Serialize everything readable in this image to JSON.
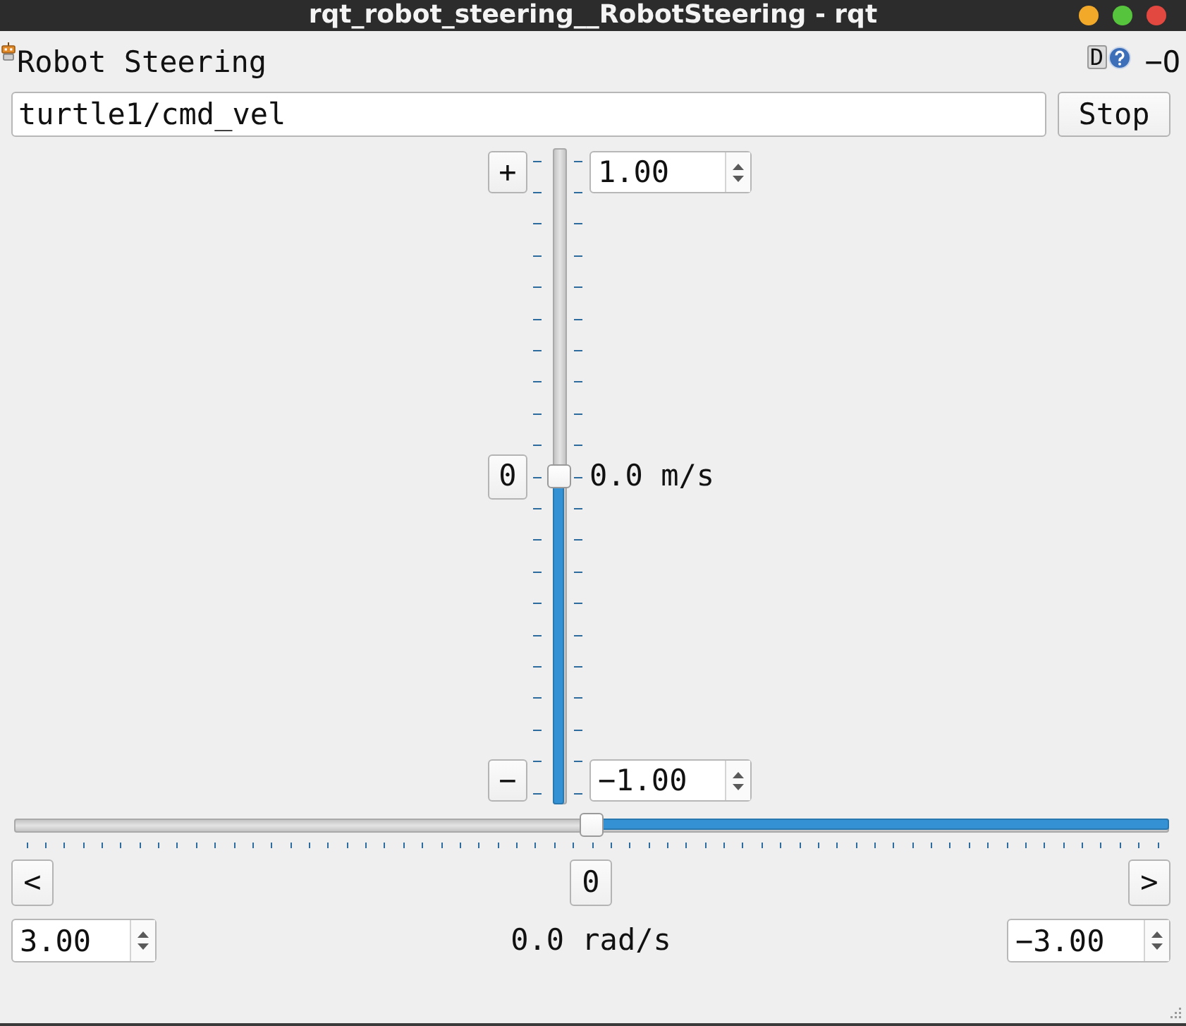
{
  "window": {
    "title": "rqt_robot_steering__RobotSteering - rqt",
    "controls": [
      {
        "color": "#f2a92a"
      },
      {
        "color": "#57c43d"
      },
      {
        "color": "#e2483f"
      }
    ]
  },
  "plugin_header": {
    "title": "Robot Steering",
    "buttons": [
      {
        "kind": "dock",
        "label": "D"
      },
      {
        "kind": "help"
      },
      {
        "kind": "glyph",
        "label": "−"
      },
      {
        "kind": "glyph",
        "label": "O"
      }
    ]
  },
  "topic": {
    "value": "turtle1/cmd_vel"
  },
  "stop_button": {
    "label": "Stop"
  },
  "linear": {
    "increase_button": "+",
    "reset_button": "0",
    "decrease_button": "−",
    "max": "1.00",
    "min": "−1.00",
    "reading": "0.0 m/s",
    "level": 0.5
  },
  "angular": {
    "left_button": "<",
    "reset_button": "0",
    "right_button": ">",
    "max": "3.00",
    "min": "−3.00",
    "reading": "0.0 rad/s",
    "level": 0.5
  }
}
